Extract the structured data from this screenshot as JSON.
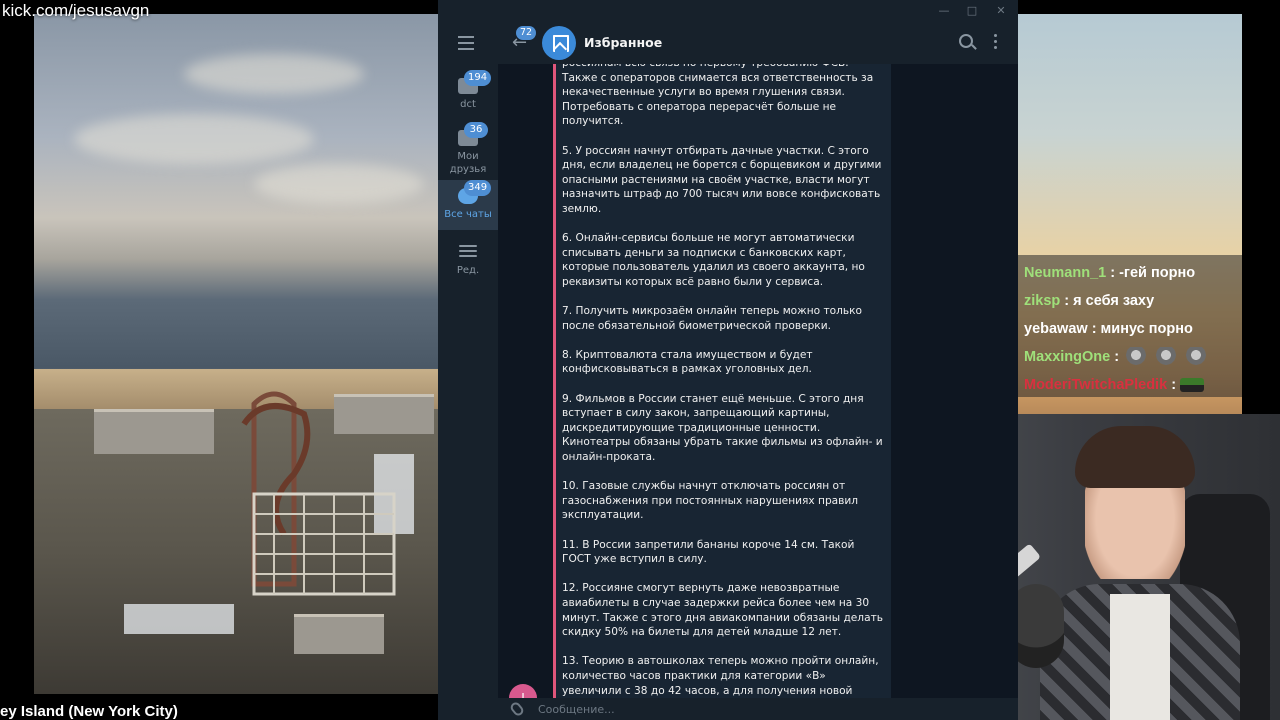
{
  "overlay": {
    "stream_url": "kick.com/jesusavgn",
    "location_label": "ey Island (New York City)"
  },
  "chat_overlay": {
    "messages": [
      {
        "user": "Neumann_1",
        "color": "#9fe07a",
        "text": ": -гей порно"
      },
      {
        "user": "ziksp",
        "color": "#9fe07a",
        "text": ": я себя заху"
      },
      {
        "user": "yebawaw",
        "color": "#ffffff",
        "text": ": минус порно"
      },
      {
        "user": "MaxxingOne",
        "color": "#9fe07a",
        "text": ":",
        "emotes": 3
      },
      {
        "user": "ModeriTwitchaPledik",
        "color": "#d9303f",
        "text": ":",
        "emotes_car": 1
      }
    ]
  },
  "telegram": {
    "sidebar": {
      "folders": [
        {
          "label": "dct",
          "badge": "194"
        },
        {
          "label": "Мои друзья",
          "badge": "36"
        },
        {
          "label": "Все чаты",
          "badge": "349",
          "active": true
        },
        {
          "label": "Ред.",
          "badge": ""
        }
      ]
    },
    "header": {
      "back_badge": "72",
      "title": "Избранное"
    },
    "message": {
      "sender_initial": "J",
      "text": "россиянам всю связь по первому требованию ФСБ. Также с операторов снимается вся ответственность за некачественные услуги во время глушения связи. Потребовать с оператора перерасчёт больше не получится.\n\n5. У россиян начнут отбирать дачные участки. С этого дня, если владелец не борется с борщевиком и другими опасными растениями на своём участке, власти могут назначить штраф до 700 тысяч или вовсе конфисковать землю.\n\n6. Онлайн-сервисы больше не могут автоматически списывать деньги за подписки с банковских карт, которые пользователь удалил из своего аккаунта, но реквизиты которых всё равно были у сервиса.\n\n7. Получить микрозаём онлайн теперь можно только после обязательной биометрической проверки.\n\n8. Криптовалюта стала имуществом и будет конфисковываться в рамках уголовных дел.\n\n9. Фильмов в России станет ещё меньше. С этого дня вступает в силу закон, запрещающий картины, дискредитирующие традиционные ценности. Кинотеатры обязаны убрать такие фильмы из офлайн- и онлайн-проката.\n\n10. Газовые службы начнут отключать россиян от газоснабжения при постоянных нарушениях правил эксплуатации.\n\n11. В России запретили бананы короче 14 см. Такой ГОСТ уже вступил в силу.\n\n12. Россияне смогут вернуть даже невозвратные авиабилеты в случае задержки рейса более чем на 30 минут. Также с этого дня авиакомпании обязаны делать скидку 50% на билеты для детей младше 12 лет.\n\n13. Теорию в автошколах теперь можно пройти онлайн, количество часов практики для категории «B» увеличили с 38 до 42 часов, а для получения новой категории"
    },
    "composer": {
      "placeholder": "Сообщение..."
    }
  }
}
